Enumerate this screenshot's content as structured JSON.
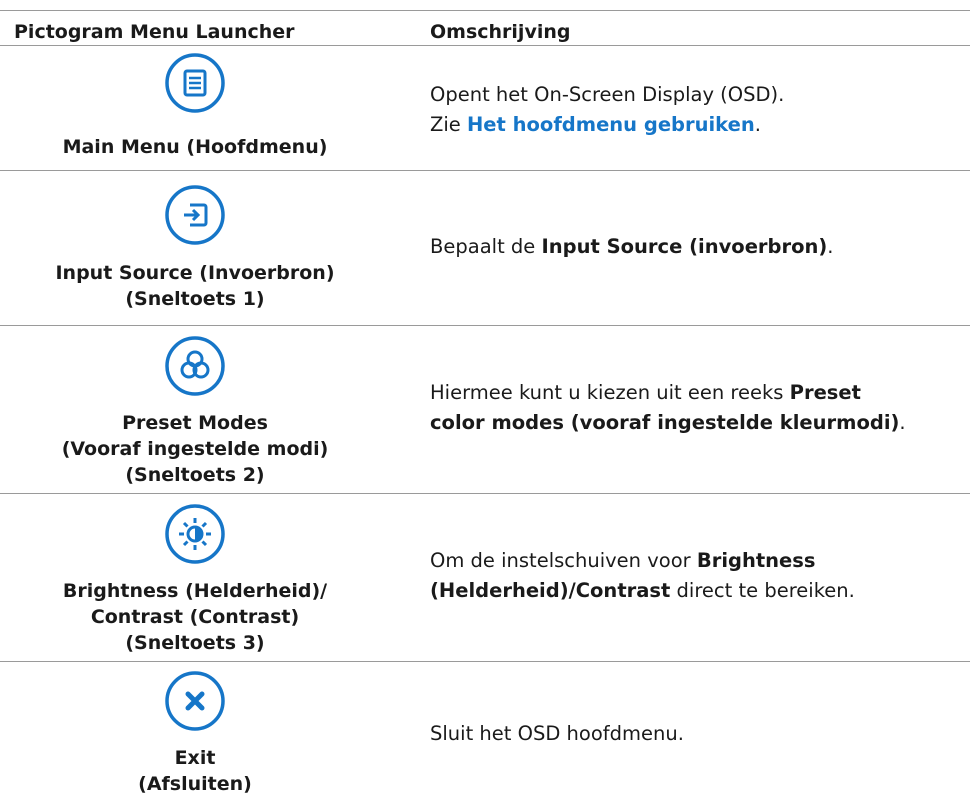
{
  "header": {
    "col1": "Pictogram Menu Launcher",
    "col2": "Omschrijving"
  },
  "rows": [
    {
      "icon": "menu-icon",
      "label_lines": [
        "Main Menu (Hoofdmenu)"
      ],
      "desc_line1": "Opent het On-Screen Display (OSD).",
      "desc_prefix": "Zie ",
      "desc_link": "Het hoofdmenu gebruiken",
      "desc_suffix": "."
    },
    {
      "icon": "input-source-icon",
      "label_lines": [
        "Input Source (Invoerbron)",
        "(Sneltoets 1)"
      ],
      "desc_prefix": "Bepaalt de ",
      "desc_bold": "Input Source (invoerbron)",
      "desc_suffix": "."
    },
    {
      "icon": "preset-modes-icon",
      "label_lines": [
        "Preset Modes",
        "(Vooraf ingestelde modi)",
        "(Sneltoets 2)"
      ],
      "desc_prefix": "Hiermee kunt u kiezen uit een reeks ",
      "desc_bold_1": "Preset",
      "desc_bold_2": "color modes (vooraf ingestelde kleurmodi)",
      "desc_suffix": "."
    },
    {
      "icon": "brightness-icon",
      "label_lines": [
        "Brightness (Helderheid)/",
        "Contrast (Contrast)",
        "(Sneltoets 3)"
      ],
      "desc_prefix": "Om de instelschuiven voor ",
      "desc_bold_1": "Brightness",
      "desc_bold_2": "(Helderheid)/Contrast",
      "desc_suffix": " direct te bereiken."
    },
    {
      "icon": "exit-icon",
      "label_lines": [
        "Exit",
        "(Afsluiten)"
      ],
      "desc": "Sluit het OSD hoofdmenu."
    }
  ],
  "colors": {
    "icon_blue": "#1676c8",
    "rule": "#9a9a9a",
    "link": "#1676c8"
  }
}
